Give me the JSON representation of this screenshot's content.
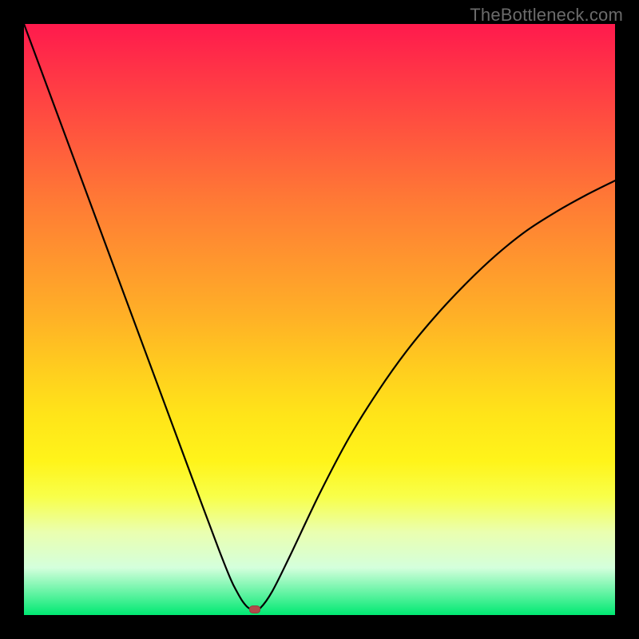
{
  "watermark": "TheBottleneck.com",
  "chart_data": {
    "type": "line",
    "title": "",
    "xlabel": "",
    "ylabel": "",
    "xlim": [
      0,
      100
    ],
    "ylim": [
      0,
      100
    ],
    "series": [
      {
        "name": "curve",
        "x": [
          0,
          5,
          10,
          15,
          20,
          25,
          30,
          33,
          35,
          36,
          37,
          38,
          39,
          40,
          42,
          45,
          50,
          55,
          60,
          65,
          70,
          75,
          80,
          85,
          90,
          95,
          100
        ],
        "values": [
          100,
          86.5,
          73,
          59.5,
          46,
          32.5,
          19,
          11,
          6,
          4,
          2.3,
          1.2,
          1.0,
          1.2,
          4,
          10,
          20.5,
          30,
          38,
          45,
          51,
          56.3,
          61,
          65,
          68.2,
          71,
          73.5
        ]
      }
    ],
    "marker": {
      "x": 39,
      "y": 1.0,
      "color": "#b24a4a"
    },
    "gradient_stops": [
      {
        "pos": 0,
        "color": "#ff1a4d"
      },
      {
        "pos": 10,
        "color": "#ff3a45"
      },
      {
        "pos": 20,
        "color": "#ff5a3d"
      },
      {
        "pos": 30,
        "color": "#ff7a35"
      },
      {
        "pos": 40,
        "color": "#ff962e"
      },
      {
        "pos": 50,
        "color": "#ffb226"
      },
      {
        "pos": 58,
        "color": "#ffcc1f"
      },
      {
        "pos": 66,
        "color": "#ffe419"
      },
      {
        "pos": 74,
        "color": "#fff41a"
      },
      {
        "pos": 80,
        "color": "#f8ff4a"
      },
      {
        "pos": 86,
        "color": "#eaffb0"
      },
      {
        "pos": 92,
        "color": "#d4ffdc"
      },
      {
        "pos": 100,
        "color": "#00e972"
      }
    ],
    "grid": false,
    "legend": false
  }
}
